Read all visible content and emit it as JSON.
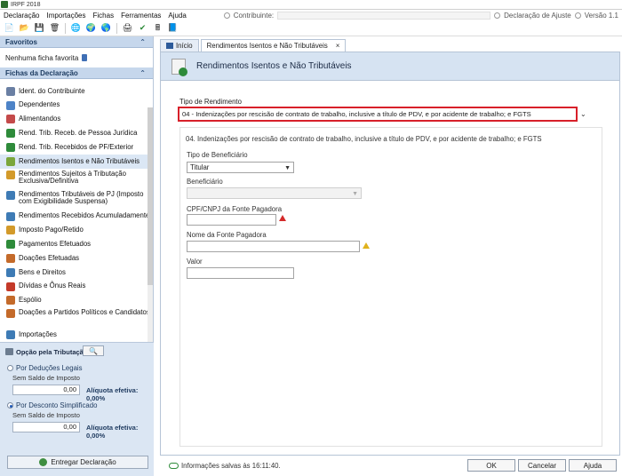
{
  "window": {
    "title": "IRPF 2018"
  },
  "menu": {
    "items": [
      "Declaração",
      "Importações",
      "Fichas",
      "Ferramentas",
      "Ajuda"
    ],
    "contribuinte_label": "Contribuinte:",
    "declaracao_ajuste": "Declaração de Ajuste",
    "versao": "Versão 1.1"
  },
  "sidebar": {
    "favoritos_title": "Favoritos",
    "favoritos_empty": "Nenhuma ficha favorita",
    "fichas_title": "Fichas da Declaração",
    "items": [
      {
        "label": "Ident. do Contribuinte",
        "color": "#6a7fa3"
      },
      {
        "label": "Dependentes",
        "color": "#4d83c7"
      },
      {
        "label": "Alimentandos",
        "color": "#c44a4a"
      },
      {
        "label": "Rend. Trib. Receb. de Pessoa Jurídica",
        "color": "#2e8b3a"
      },
      {
        "label": "Rend. Trib. Recebidos de PF/Exterior",
        "color": "#2e8b3a"
      },
      {
        "label": "Rendimentos Isentos e Não Tributáveis",
        "color": "#7aa63b"
      },
      {
        "label": "Rendimentos Sujeitos à Tributação Exclusiva/Definitiva",
        "color": "#d39a2a"
      },
      {
        "label": "Rendimentos Tributáveis de PJ (Imposto com Exigibilidade Suspensa)",
        "color": "#3e7bb5"
      },
      {
        "label": "Rendimentos Recebidos Acumuladamente",
        "color": "#3e7bb5"
      },
      {
        "label": "Imposto Pago/Retido",
        "color": "#d39a2a"
      },
      {
        "label": "Pagamentos Efetuados",
        "color": "#2e8b3a"
      },
      {
        "label": "Doações Efetuadas",
        "color": "#c46a2a"
      },
      {
        "label": "Bens e Direitos",
        "color": "#3e7bb5"
      },
      {
        "label": "Dívidas e Ônus Reais",
        "color": "#c43a2a"
      },
      {
        "label": "Espólio",
        "color": "#c46a2a"
      },
      {
        "label": "Doações a Partidos Políticos e Candidatos",
        "color": "#c46a2a"
      },
      {
        "label": "Importações",
        "color": "#3e7bb5"
      }
    ],
    "active_index": 5
  },
  "opcao": {
    "title": "Opção pela Tributação:",
    "deducoes": {
      "label": "Por Deduções Legais",
      "saldo_label": "Sem Saldo de Imposto",
      "value": "0,00",
      "aliquota": "Alíquota efetiva: 0,00%"
    },
    "simplificado": {
      "label": "Por Desconto Simplificado",
      "saldo_label": "Sem Saldo de Imposto",
      "value": "0,00",
      "aliquota": "Alíquota efetiva: 0,00%"
    },
    "entregar": "Entregar Declaração"
  },
  "tabs": [
    {
      "label": "Início"
    },
    {
      "label": "Rendimentos Isentos e Não Tributáveis"
    }
  ],
  "page": {
    "title": "Rendimentos Isentos e Não Tributáveis",
    "tipo_label": "Tipo de Rendimento",
    "tipo_value": "04 - Indenizações por rescisão de contrato de trabalho, inclusive a título de PDV, e por acidente de trabalho; e FGTS",
    "section_title": "04. Indenizações por rescisão de contrato de trabalho, inclusive a título de PDV, e por acidente de trabalho; e FGTS",
    "tipo_beneficiario_label": "Tipo de Beneficiário",
    "tipo_beneficiario_value": "Titular",
    "beneficiario_label": "Beneficiário",
    "cpf_label": "CPF/CNPJ da Fonte Pagadora",
    "nome_label": "Nome da Fonte Pagadora",
    "valor_label": "Valor"
  },
  "status": {
    "text": "Informações salvas às 16:11:40.",
    "ok": "OK",
    "cancelar": "Cancelar",
    "ajuda": "Ajuda"
  }
}
